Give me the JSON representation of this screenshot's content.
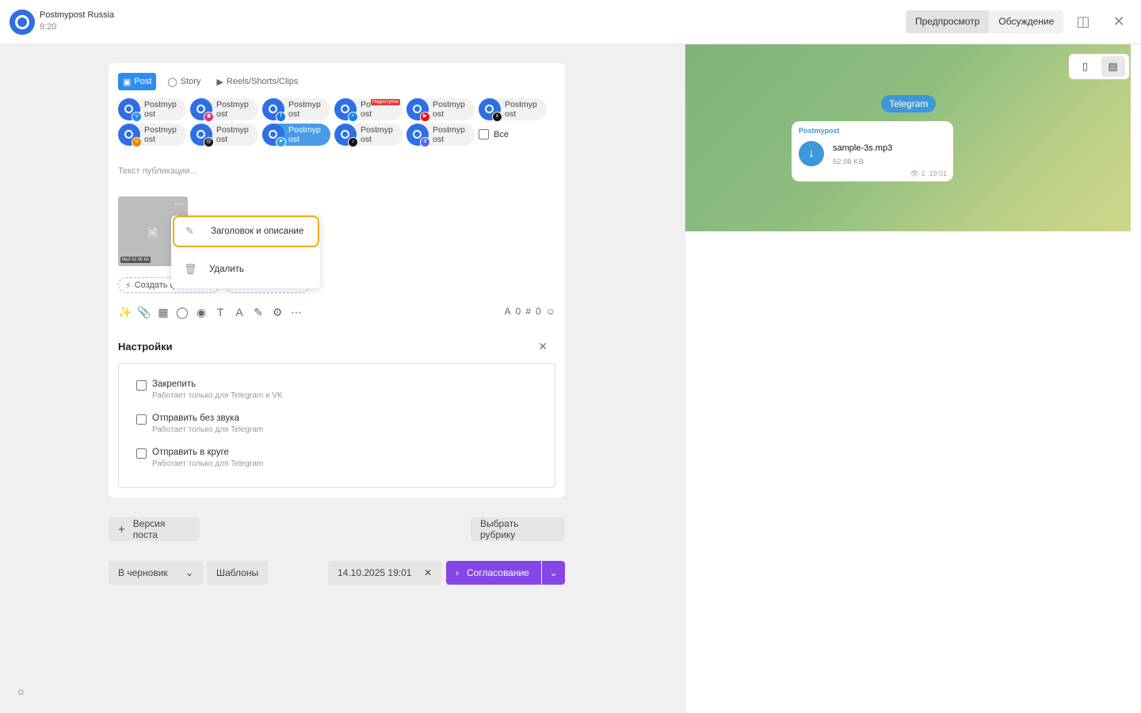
{
  "header": {
    "app_name": "Postmypost Russia",
    "time": "9:20",
    "tabs": [
      "Предпросмотр",
      "Обсуждение"
    ],
    "active_tab": "Предпросмотр"
  },
  "composer": {
    "type_tabs": [
      "Post",
      "Story",
      "Reels/Shorts/Clips"
    ],
    "active_type": "Post",
    "accounts": [
      {
        "name_l1": "Postmyp",
        "name_l2": "ost",
        "network": "vk",
        "color": "#2787f5",
        "selected": false
      },
      {
        "name_l1": "Postmyp",
        "name_l2": "ost",
        "network": "instagram",
        "color": "#e1306c",
        "selected": false
      },
      {
        "name_l1": "Postmyp",
        "name_l2": "ost",
        "network": "facebook",
        "color": "#1877f2",
        "selected": false
      },
      {
        "name_l1": "Po",
        "name_l2": "ost",
        "network": "bluesky",
        "color": "#1185fe",
        "selected": false,
        "unavailable": "Недоступно"
      },
      {
        "name_l1": "Postmyp",
        "name_l2": "ost",
        "network": "youtube",
        "color": "#ff0000",
        "selected": false
      },
      {
        "name_l1": "Postmyp",
        "name_l2": "ost",
        "network": "x",
        "color": "#111111",
        "selected": false
      },
      {
        "name_l1": "Postmyp",
        "name_l2": "ost",
        "network": "ok",
        "color": "#ee8208",
        "selected": false
      },
      {
        "name_l1": "Postmyp",
        "name_l2": "ost",
        "network": "threads",
        "color": "#111111",
        "selected": false
      },
      {
        "name_l1": "Postmyp",
        "name_l2": "ost",
        "network": "telegram",
        "color": "#2aa3df",
        "selected": true
      },
      {
        "name_l1": "Postmyp",
        "name_l2": "ost",
        "network": "tiktok",
        "color": "#111111",
        "selected": false
      },
      {
        "name_l1": "Postmyp",
        "name_l2": "ost",
        "network": "discord",
        "color": "#5865f2",
        "selected": false
      }
    ],
    "all_label": "Все",
    "text_placeholder": "Текст публикации...",
    "media": {
      "tag": "Mp3 52.08 Kb"
    },
    "ai_chips": [
      "Создать фото с ИИ",
      "Написать с ИИ"
    ],
    "context_menu": [
      "Заголовок и описание",
      "Удалить"
    ],
    "counters": {
      "chars": "0",
      "hashtags": "0"
    }
  },
  "settings": {
    "title": "Настройки",
    "options": [
      {
        "label": "Закрепить",
        "hint": "Работает только для Telegram и VK"
      },
      {
        "label": "Отправить без звука",
        "hint": "Работает только для Telegram"
      },
      {
        "label": "Отправить в круге",
        "hint": "Работает только для Telegram"
      }
    ]
  },
  "actions": {
    "version": "Версия поста",
    "rubric": "Выбрать рубрику",
    "status": "В черновик",
    "templates": "Шаблоны",
    "datetime": "14.10.2025 19:01",
    "submit": "Согласование"
  },
  "preview": {
    "channel": "Telegram",
    "sender": "Postmypost",
    "file_name": "sample-3s.mp3",
    "file_size": "52.08 KB",
    "views": "1",
    "time": "19:01"
  },
  "colors": {
    "accent": "#8446e6",
    "primary_blue": "#2f8df0",
    "highlight": "#f0aa00"
  }
}
